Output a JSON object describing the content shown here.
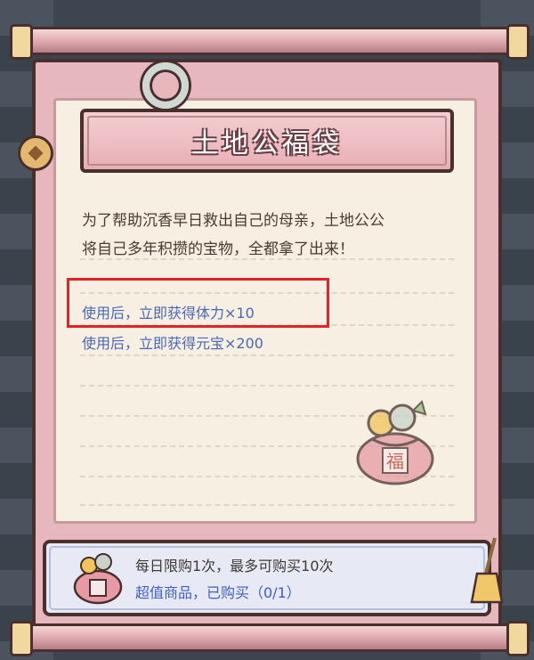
{
  "item": {
    "title": "土地公福袋",
    "description_line1": "为了帮助沉香早日救出自己的母亲，土地公公",
    "description_line2": "将自己多年积攒的宝物，全都拿了出来！",
    "effects": [
      "使用后，立即获得体力×10",
      "使用后，立即获得元宝×200"
    ],
    "bag_glyph": "福"
  },
  "purchase": {
    "limit_text": "每日限购1次，最多可购买10次",
    "status_text": "超值商品，已购买（0/1）"
  },
  "colors": {
    "frame_pink": "#e6b8bd",
    "paper": "#f6efe2",
    "effect_blue": "#4a68b8",
    "highlight_red": "#e0222a"
  }
}
